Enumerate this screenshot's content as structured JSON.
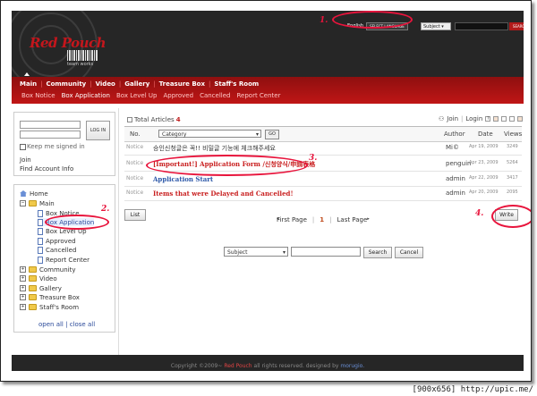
{
  "header": {
    "logo_text": "Red Pouch",
    "logo_sub": "team works",
    "lang_label": "English",
    "lang_button": "SELECT LANGUAGE",
    "search_scope": "Subject",
    "search_button": "SEARCH"
  },
  "nav": {
    "main": [
      "Main",
      "Community",
      "Video",
      "Gallery",
      "Treasure Box",
      "Staff's Room"
    ],
    "sub": [
      "Box Notice",
      "Box Application",
      "Box Level Up",
      "Approved",
      "Cancelled",
      "Report Center"
    ],
    "sub_active_index": 1
  },
  "login": {
    "button": "LOG IN",
    "keep": "Keep me signed in",
    "join": "Join",
    "find": "Find Account Info"
  },
  "tree": {
    "home": "Home",
    "main": "Main",
    "children": [
      "Box Notice",
      "Box Application",
      "Box Level Up",
      "Approved",
      "Cancelled",
      "Report Center"
    ],
    "folders": [
      "Community",
      "Video",
      "Gallery",
      "Treasure Box",
      "Staff's Room"
    ],
    "open_all": "open all",
    "close_all": "close all",
    "divider": "|"
  },
  "board": {
    "total_label": "Total Articles",
    "total_count": "4",
    "join": "Join",
    "login": "Login",
    "help": "?",
    "no_label": "No.",
    "category_label": "Category",
    "go": "GO",
    "author_label": "Author",
    "date_label": "Date",
    "views_label": "Views",
    "rows": [
      {
        "no": "Notice",
        "title": "승인신청글은 꼭!! 비밀글 기능에 체크해주세요",
        "author": "Mi©",
        "date": "Apr 19, 2009",
        "views": "3249"
      },
      {
        "no": "Notice",
        "title": "[Important!] Application Form /신청양식/申請表格",
        "author": "penguin",
        "date": "Apr 23, 2009",
        "views": "5264"
      },
      {
        "no": "Notice",
        "title": "Application Start",
        "author": "admin",
        "date": "Apr 22, 2009",
        "views": "3417"
      },
      {
        "no": "Notice",
        "title": "Items that were Delayed and Cancelled!",
        "author": "admin",
        "date": "Apr 20, 2009",
        "views": "2095"
      }
    ],
    "list_button": "List",
    "write_button": "Write",
    "first_page": "First Page",
    "current_page": "1",
    "last_page": "Last Page",
    "search_scope": "Subject",
    "search_button": "Search",
    "cancel_button": "Cancel"
  },
  "footer": {
    "pre": "Copyright ©2009~",
    "brand": "Red Pouch",
    "mid": "all rights reserved. designed by",
    "designer": "morugio."
  },
  "annotations": [
    "1.",
    "2.",
    "3.",
    "4."
  ],
  "watermark": "[900x656] http://upic.me/",
  "colors": {
    "accent": "#c01616",
    "annotation": "#e8143c",
    "link": "#2c4b9a"
  }
}
